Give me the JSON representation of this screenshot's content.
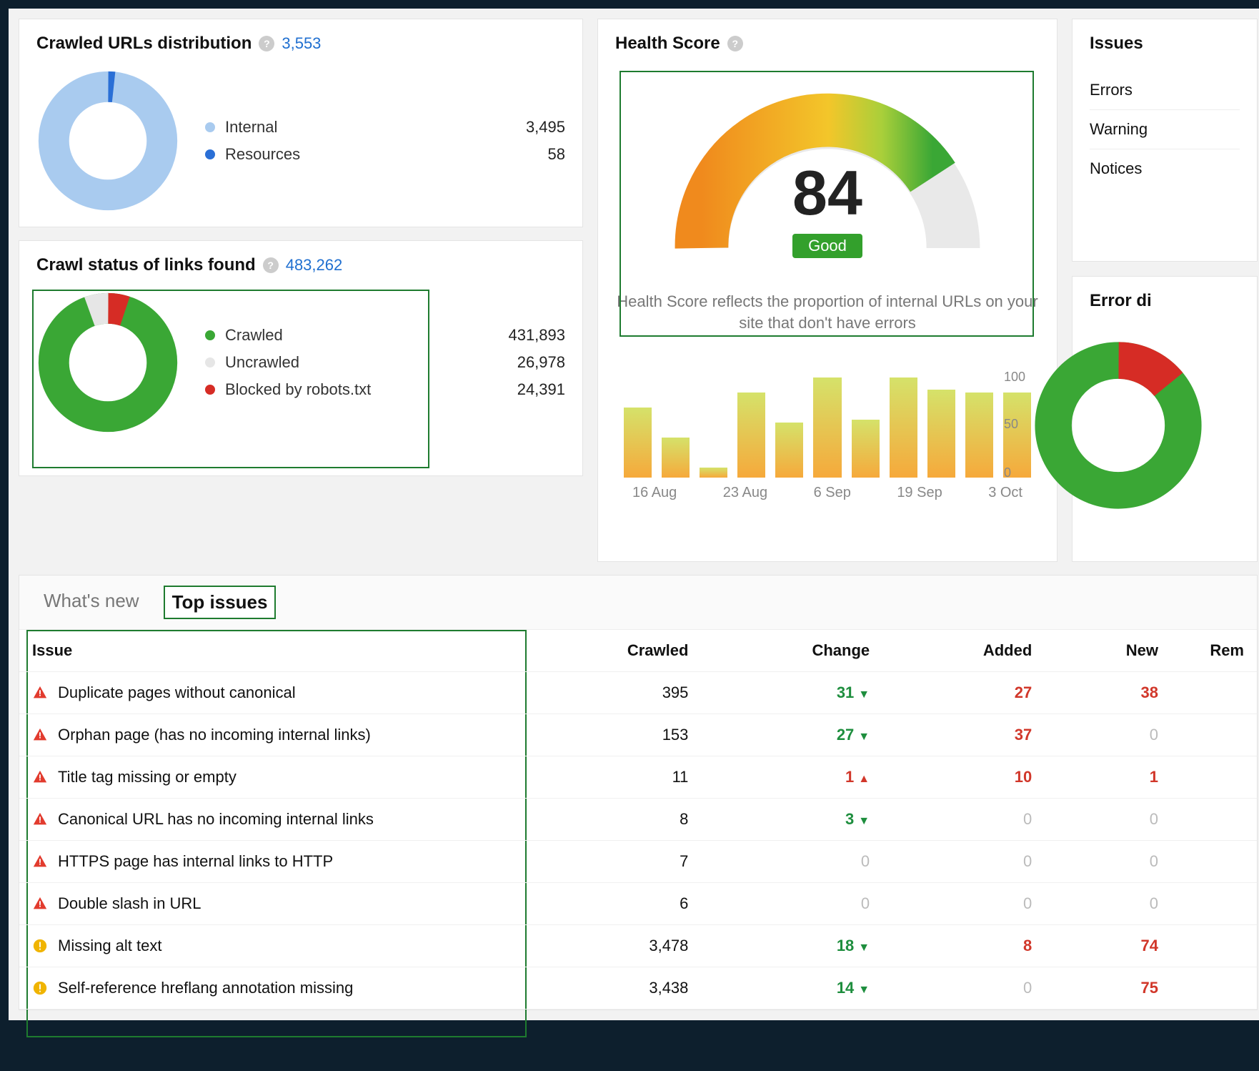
{
  "crawled_dist": {
    "title": "Crawled URLs distribution",
    "total": "3,553",
    "legend": [
      {
        "label": "Internal",
        "value": "3,495",
        "color": "#a9cbef"
      },
      {
        "label": "Resources",
        "value": "58",
        "color": "#2a6fd6"
      }
    ]
  },
  "crawl_status": {
    "title": "Crawl status of links found",
    "total": "483,262",
    "legend": [
      {
        "label": "Crawled",
        "value": "431,893",
        "color": "#3aa735"
      },
      {
        "label": "Uncrawled",
        "value": "26,978",
        "color": "#e6e6e6"
      },
      {
        "label": "Blocked by robots.txt",
        "value": "24,391",
        "color": "#d62c25"
      }
    ]
  },
  "health": {
    "title": "Health Score",
    "score": "84",
    "badge": "Good",
    "desc": "Health Score reflects the proportion of internal URLs on your site that don't have errors",
    "y0": "0",
    "y50": "50",
    "y100": "100",
    "xlabels": [
      "16 Aug",
      "23 Aug",
      "6 Sep",
      "19 Sep",
      "3 Oct"
    ]
  },
  "issues_right": {
    "title": "Issues",
    "rows": [
      {
        "label": "Errors"
      },
      {
        "label": "Warning"
      },
      {
        "label": "Notices"
      }
    ]
  },
  "error_dist": {
    "title": "Error di"
  },
  "tabs": {
    "whatsnew": "What's new",
    "topissues": "Top issues"
  },
  "table": {
    "headers": {
      "issue": "Issue",
      "crawled": "Crawled",
      "change": "Change",
      "added": "Added",
      "new": "New",
      "rem": "Rem"
    },
    "rows": [
      {
        "sev": "err",
        "name": "Duplicate pages without canonical",
        "crawled": "395",
        "change": "31",
        "dir": "down",
        "added": "27",
        "new": "38"
      },
      {
        "sev": "err",
        "name": "Orphan page (has no incoming internal links)",
        "crawled": "153",
        "change": "27",
        "dir": "down",
        "added": "37",
        "new": "0"
      },
      {
        "sev": "err",
        "name": "Title tag missing or empty",
        "crawled": "11",
        "change": "1",
        "dir": "up",
        "added": "10",
        "new": "1"
      },
      {
        "sev": "err",
        "name": "Canonical URL has no incoming internal links",
        "crawled": "8",
        "change": "3",
        "dir": "down",
        "added": "0",
        "new": "0"
      },
      {
        "sev": "err",
        "name": "HTTPS page has internal links to HTTP",
        "crawled": "7",
        "change": "0",
        "dir": "none",
        "added": "0",
        "new": "0"
      },
      {
        "sev": "err",
        "name": "Double slash in URL",
        "crawled": "6",
        "change": "0",
        "dir": "none",
        "added": "0",
        "new": "0"
      },
      {
        "sev": "warn",
        "name": "Missing alt text",
        "crawled": "3,478",
        "change": "18",
        "dir": "down",
        "added": "8",
        "new": "74"
      },
      {
        "sev": "warn",
        "name": "Self-reference hreflang annotation missing",
        "crawled": "3,438",
        "change": "14",
        "dir": "down",
        "added": "0",
        "new": "75"
      }
    ]
  },
  "chart_data": [
    {
      "type": "pie",
      "title": "Crawled URLs distribution",
      "series": [
        {
          "name": "Internal",
          "value": 3495
        },
        {
          "name": "Resources",
          "value": 58
        }
      ],
      "total": 3553
    },
    {
      "type": "pie",
      "title": "Crawl status of links found",
      "series": [
        {
          "name": "Crawled",
          "value": 431893
        },
        {
          "name": "Uncrawled",
          "value": 26978
        },
        {
          "name": "Blocked by robots.txt",
          "value": 24391
        }
      ],
      "total": 483262
    },
    {
      "type": "bar",
      "title": "Health Score history",
      "categories": [
        "16 Aug",
        "",
        "23 Aug",
        "",
        "",
        "6 Sep",
        "",
        "",
        "19 Sep",
        "",
        "3 Oct"
      ],
      "values": [
        70,
        40,
        10,
        85,
        55,
        100,
        58,
        100,
        88,
        85,
        85
      ],
      "ylim": [
        0,
        100
      ],
      "ylabel": "Health Score"
    },
    {
      "type": "gauge",
      "title": "Health Score",
      "value": 84,
      "range": [
        0,
        100
      ],
      "label": "Good"
    }
  ]
}
